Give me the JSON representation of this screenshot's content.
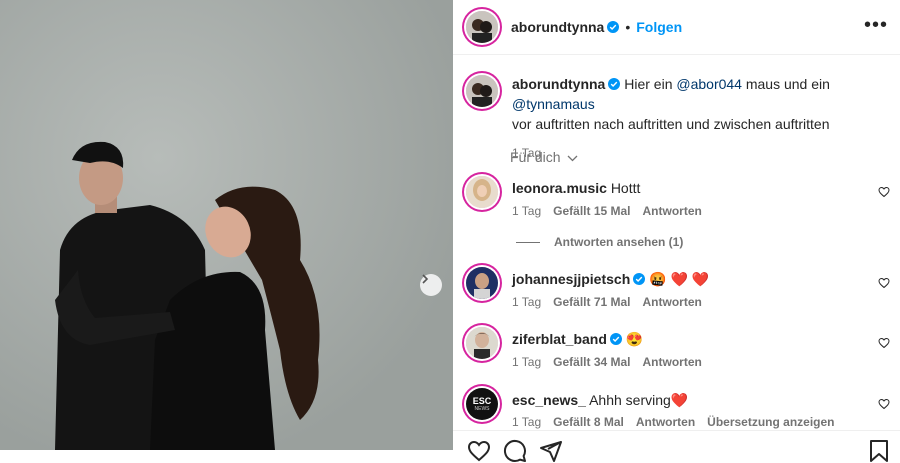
{
  "post": {
    "author": "aborundtynna",
    "follow_label": "Folgen",
    "more_label": "•••",
    "caption_prefix": "Hier ein",
    "mention_1": "@abor044",
    "caption_mid": "maus und ein",
    "mention_2": "@tynnamaus",
    "caption_line_2": "vor auftritten nach auftritten und zwischen auftritten",
    "time": "1 Tag",
    "for_you_label": "Für dich"
  },
  "comments": [
    {
      "user": "leonora.music",
      "text": "Hottt",
      "time": "1 Tag",
      "likes": "Gefällt 15 Mal",
      "reply": "Antworten",
      "verified": false
    },
    {
      "user": "johannesjjpietsch",
      "text": "🤬 ❤️ ❤️",
      "time": "1 Tag",
      "likes": "Gefällt 71 Mal",
      "reply": "Antworten",
      "verified": true
    },
    {
      "user": "ziferblat_band",
      "text": "😍",
      "time": "1 Tag",
      "likes": "Gefällt 34 Mal",
      "reply": "Antworten",
      "verified": true
    },
    {
      "user": "esc_news_",
      "text": "Ahhh serving❤️",
      "time": "1 Tag",
      "likes": "Gefällt 8 Mal",
      "reply": "Antworten",
      "translate": "Übersetzung anzeigen",
      "verified": false
    }
  ],
  "view_replies_label": "Antworten ansehen (1)",
  "esc_avatar_text": [
    "ESC",
    "NEWS"
  ],
  "colors": {
    "accent": "#0095f6",
    "verified": "#0095f6",
    "mention": "#00376b",
    "secondary": "#737373"
  },
  "icons": [
    "verified-badge-icon",
    "more-options-icon",
    "chevron-down-icon",
    "heart-icon",
    "chevron-right-icon",
    "comment-icon",
    "share-icon",
    "bookmark-icon"
  ]
}
